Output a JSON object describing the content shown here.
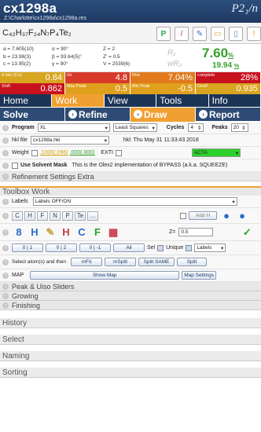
{
  "header": {
    "title": "cx1298a",
    "path": "Z:\\Charlotte\\cx1298a\\cx1298a.res",
    "space_group": "P2₁/n"
  },
  "formula": "C₄₂H₃₇F₂₄N₇P₄Te₂",
  "cell": {
    "a": "a = 7.605(10)",
    "b": "b = 23.98(3)",
    "c": "c = 13.95(2)",
    "alpha": "α = 90°",
    "beta": "β = 93.64(5)°",
    "gamma": "γ = 90°",
    "z": "Z = 2",
    "zp": "Z' = 0.5",
    "v": "V = 2539(6)",
    "r1_label": "R₁",
    "wr2_label": "wR₂",
    "r1": "7.60",
    "r1_unit": "%",
    "wr2": "19.94",
    "wr2_unit": "%"
  },
  "stats": [
    {
      "label": "d min (Cu)",
      "value": "0.84",
      "color": "#d8a520"
    },
    {
      "label": "I/σ",
      "value": "4.8",
      "color": "#d83a2a"
    },
    {
      "label": "Rint",
      "value": "7.04%",
      "color": "#e07a1d"
    },
    {
      "label": "complete",
      "value": "28%",
      "color": "#c8121e"
    },
    {
      "label": "Shift",
      "value": "0.862",
      "color": "#c8121e"
    },
    {
      "label": "Max Peak",
      "value": "0.5",
      "color": "#e0a01d"
    },
    {
      "label": "Min Peak",
      "value": "-0.5",
      "color": "#e0a01d"
    },
    {
      "label": "GooF",
      "value": "0.935",
      "color": "#d8a520"
    }
  ],
  "tabs": [
    "Home",
    "Work",
    "View",
    "Tools",
    "Info"
  ],
  "active_tab": "Work",
  "subtabs": [
    "Solve",
    "Refine",
    "Draw",
    "Report"
  ],
  "solve": {
    "program_label": "Program",
    "program": "XL",
    "method": "Least Squares",
    "cycles_label": "Cycles",
    "cycles": "4",
    "peaks_label": "Peaks",
    "peaks": "20",
    "hkl_label": "hkl file",
    "hkl_file": "cx1298a.hkl",
    "hkl_date": "hkl: Thu May 31 11:33:43 2018",
    "weight_label": "Weight",
    "weight_a": ".1000(.096)",
    "weight_b": ".000(.000)",
    "exti_label": "EXTI",
    "acta": "ACTA"
  },
  "solvent": {
    "label": "Use Solvent Mask",
    "desc": "This is the Olex2 implementation of BYPASS (a.k.a. SQUEEZE)"
  },
  "refine_extras": "Refinement Settings Extra",
  "toolbox": {
    "title": "Toolbox Work",
    "labels_label": "Labels",
    "labels_value": "Labels OFF/ON",
    "elements": [
      "C",
      "H",
      "F",
      "N",
      "P",
      "Te",
      "..."
    ],
    "add_h": "Add H",
    "z_label": "Z=",
    "z_value": "0.5",
    "parts": [
      "0 | 1",
      "0 | 2",
      "0 | -1",
      "All"
    ],
    "sel": "Sel",
    "unique": "Unique",
    "labels_sel": "Labels",
    "select_text": "Select atom(s) and then",
    "fit": [
      "mFit",
      "mSplit",
      "Split SAME",
      "Split"
    ],
    "map": "MAP",
    "show_map": "Show Map",
    "map_settings": "Map Settings",
    "peaks": "Peak & Uiso Sliders",
    "growing": "Growing",
    "finishing": "Finishing"
  },
  "sections": [
    "History",
    "Select",
    "Naming",
    "Sorting"
  ]
}
